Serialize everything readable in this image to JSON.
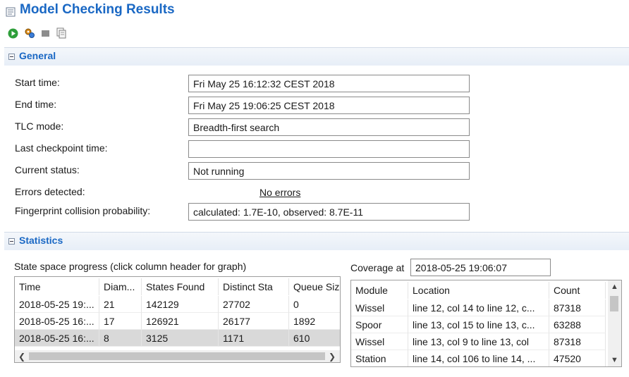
{
  "header": {
    "title": "Model Checking Results",
    "title_icon": "results-view-icon"
  },
  "toolbar": {
    "buttons": [
      {
        "name": "run-icon",
        "tooltip": "Run"
      },
      {
        "name": "run-options-icon",
        "tooltip": "Run options"
      },
      {
        "name": "stop-icon",
        "tooltip": "Stop"
      },
      {
        "name": "copy-icon",
        "tooltip": "Copy"
      }
    ]
  },
  "general": {
    "title": "General",
    "start_time_label": "Start time:",
    "start_time_value": "Fri May 25 16:12:32 CEST 2018",
    "end_time_label": "End time:",
    "end_time_value": "Fri May 25 19:06:25 CEST 2018",
    "tlc_mode_label": "TLC mode:",
    "tlc_mode_value": "Breadth-first search",
    "checkpoint_label": "Last checkpoint time:",
    "checkpoint_value": "",
    "status_label": "Current status:",
    "status_value": "Not running",
    "errors_label": "Errors detected:",
    "errors_value": "No errors",
    "fp_label": "Fingerprint collision probability:",
    "fp_value": "calculated: 1.7E-10,  observed: 8.7E-11"
  },
  "statistics": {
    "title": "Statistics",
    "progress_title": "State space progress (click column header for graph)",
    "progress_columns": [
      "Time",
      "Diam...",
      "States Found",
      "Distinct Sta",
      "Queue Siz"
    ],
    "progress_rows": [
      [
        "2018-05-25 19:...",
        "21",
        "142129",
        "27702",
        "0"
      ],
      [
        "2018-05-25 16:...",
        "17",
        "126921",
        "26177",
        "1892"
      ],
      [
        "2018-05-25 16:...",
        "8",
        "3125",
        "1171",
        "610"
      ]
    ],
    "selected_row": 2,
    "coverage_label": "Coverage at",
    "coverage_time": "2018-05-25 19:06:07",
    "coverage_columns": [
      "Module",
      "Location",
      "Count"
    ],
    "coverage_rows": [
      [
        "Wissel",
        "line 12, col 14 to line 12, c...",
        "87318"
      ],
      [
        "Spoor",
        "line 13, col 15 to line 13, c...",
        "63288"
      ],
      [
        "Wissel",
        "line 13, col 9 to line 13, col",
        "87318"
      ],
      [
        "Station",
        "line 14, col 106 to line 14, ...",
        "47520"
      ]
    ]
  },
  "colors": {
    "accent": "#1a68c4",
    "section_bg": "#e7eef7",
    "selected_row": "#d9d9d9"
  }
}
